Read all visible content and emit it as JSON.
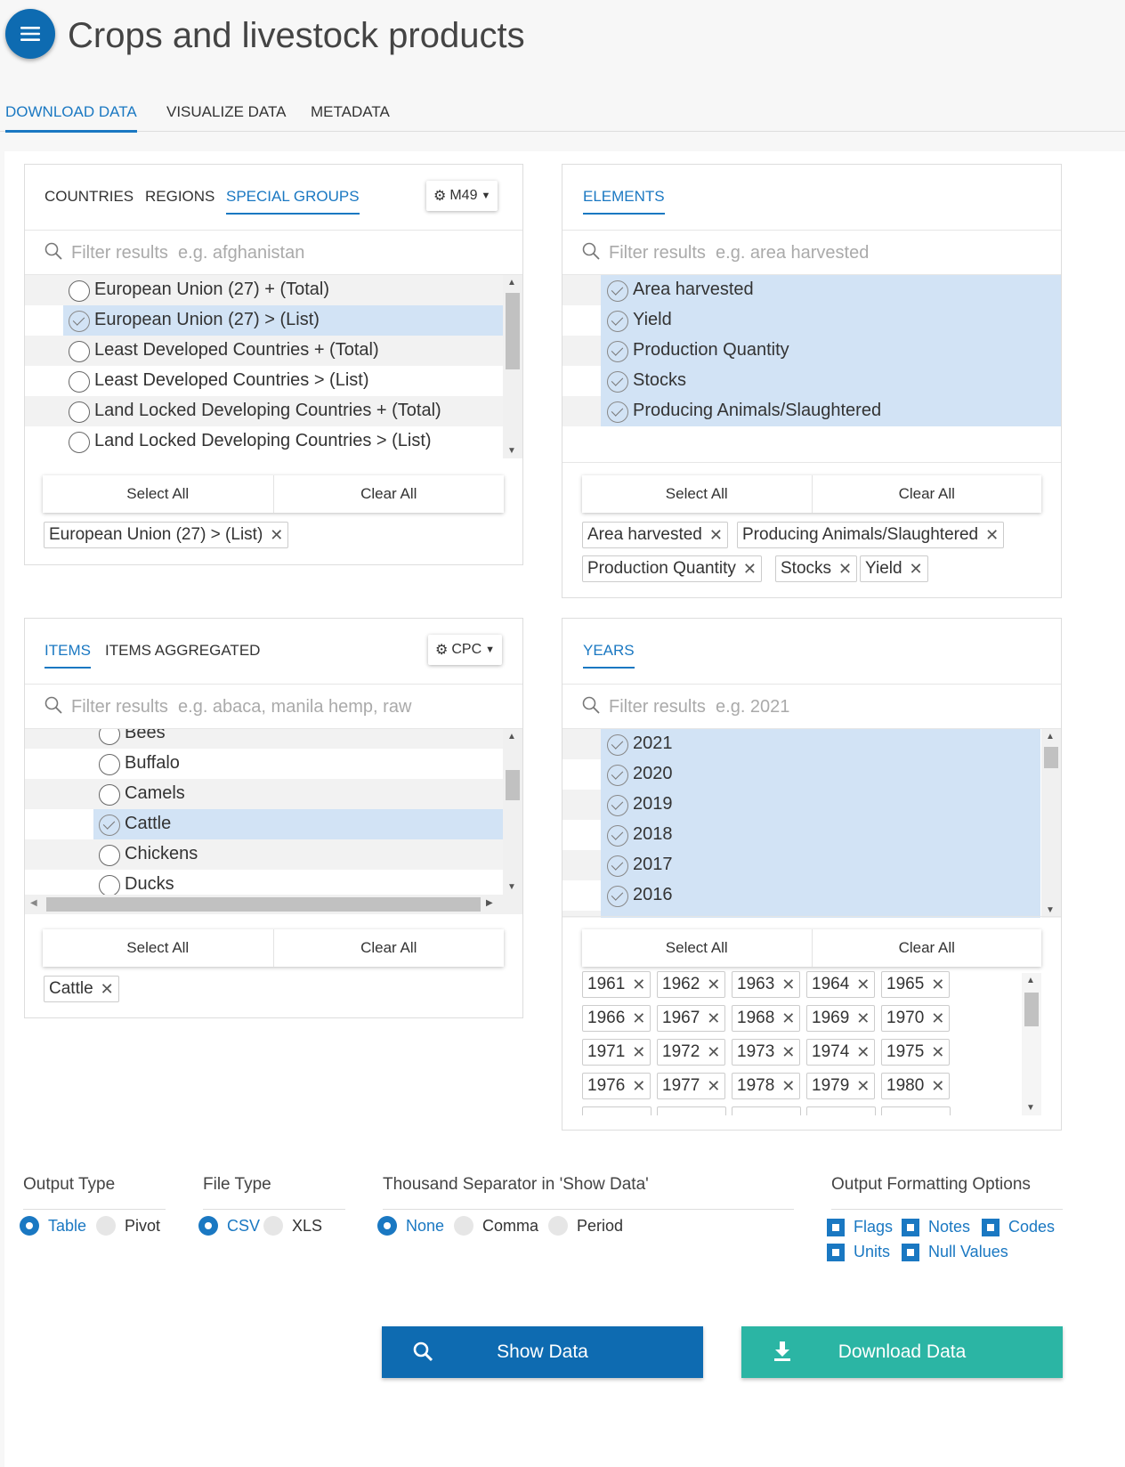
{
  "app": {
    "title": "Crops and livestock products"
  },
  "tabs": [
    {
      "label": "DOWNLOAD DATA",
      "active": true
    },
    {
      "label": "VISUALIZE DATA",
      "active": false
    },
    {
      "label": "METADATA",
      "active": false
    }
  ],
  "countries": {
    "tabs": [
      "COUNTRIES",
      "REGIONS",
      "SPECIAL GROUPS"
    ],
    "active_tab": "SPECIAL GROUPS",
    "code_label": "M49",
    "filter_placeholder": "Filter results  e.g. afghanistan",
    "items": [
      {
        "label": "European Union (27) + (Total)",
        "selected": false
      },
      {
        "label": "European Union (27) > (List)",
        "selected": true
      },
      {
        "label": "Least Developed Countries + (Total)",
        "selected": false
      },
      {
        "label": "Least Developed Countries > (List)",
        "selected": false
      },
      {
        "label": "Land Locked Developing Countries + (Total)",
        "selected": false
      },
      {
        "label": "Land Locked Developing Countries > (List)",
        "selected": false
      }
    ],
    "select_all": "Select All",
    "clear_all": "Clear All",
    "chips": [
      "European Union (27) > (List)"
    ]
  },
  "elements": {
    "tabs": [
      "ELEMENTS"
    ],
    "filter_placeholder": "Filter results  e.g. area harvested",
    "items": [
      {
        "label": "Area harvested",
        "selected": true
      },
      {
        "label": "Yield",
        "selected": true
      },
      {
        "label": "Production Quantity",
        "selected": true
      },
      {
        "label": "Stocks",
        "selected": true
      },
      {
        "label": "Producing Animals/Slaughtered",
        "selected": true
      }
    ],
    "select_all": "Select All",
    "clear_all": "Clear All",
    "chips": [
      "Area harvested",
      "Producing Animals/Slaughtered",
      "Production Quantity",
      "Stocks",
      "Yield"
    ]
  },
  "items": {
    "tabs": [
      "ITEMS",
      "ITEMS AGGREGATED"
    ],
    "active_tab": "ITEMS",
    "code_label": "CPC",
    "filter_placeholder": "Filter results  e.g. abaca, manila hemp, raw",
    "items": [
      {
        "label": "Bees",
        "selected": false
      },
      {
        "label": "Buffalo",
        "selected": false
      },
      {
        "label": "Camels",
        "selected": false
      },
      {
        "label": "Cattle",
        "selected": true
      },
      {
        "label": "Chickens",
        "selected": false
      },
      {
        "label": "Ducks",
        "selected": false
      }
    ],
    "select_all": "Select All",
    "clear_all": "Clear All",
    "chips": [
      "Cattle"
    ]
  },
  "years": {
    "tabs": [
      "YEARS"
    ],
    "filter_placeholder": "Filter results  e.g. 2021",
    "items": [
      {
        "label": "2021",
        "selected": true
      },
      {
        "label": "2020",
        "selected": true
      },
      {
        "label": "2019",
        "selected": true
      },
      {
        "label": "2018",
        "selected": true
      },
      {
        "label": "2017",
        "selected": true
      },
      {
        "label": "2016",
        "selected": true
      }
    ],
    "select_all": "Select All",
    "clear_all": "Clear All",
    "chips": [
      "1961",
      "1962",
      "1963",
      "1964",
      "1965",
      "1966",
      "1967",
      "1968",
      "1969",
      "1970",
      "1971",
      "1972",
      "1973",
      "1974",
      "1975",
      "1976",
      "1977",
      "1978",
      "1979",
      "1980"
    ]
  },
  "options": {
    "output_type": {
      "title": "Output Type",
      "choices": [
        "Table",
        "Pivot"
      ],
      "selected": "Table"
    },
    "file_type": {
      "title": "File Type",
      "choices": [
        "CSV",
        "XLS"
      ],
      "selected": "CSV"
    },
    "thousand_separator": {
      "title": "Thousand Separator in 'Show Data'",
      "choices": [
        "None",
        "Comma",
        "Period"
      ],
      "selected": "None"
    },
    "formatting": {
      "title": "Output Formatting Options",
      "checks": [
        "Flags",
        "Notes",
        "Codes",
        "Units",
        "Null Values"
      ]
    }
  },
  "actions": {
    "show_data": "Show Data",
    "download_data": "Download Data"
  },
  "colors": {
    "primary": "#0e6bb1",
    "accent_blue": "#1a78c2",
    "selected_row": "#d2e3f5",
    "download": "#2bb5a4"
  },
  "icons": {
    "menu": "hamburger-icon",
    "search": "search-icon",
    "settings": "gear-icon",
    "download": "download-icon"
  }
}
